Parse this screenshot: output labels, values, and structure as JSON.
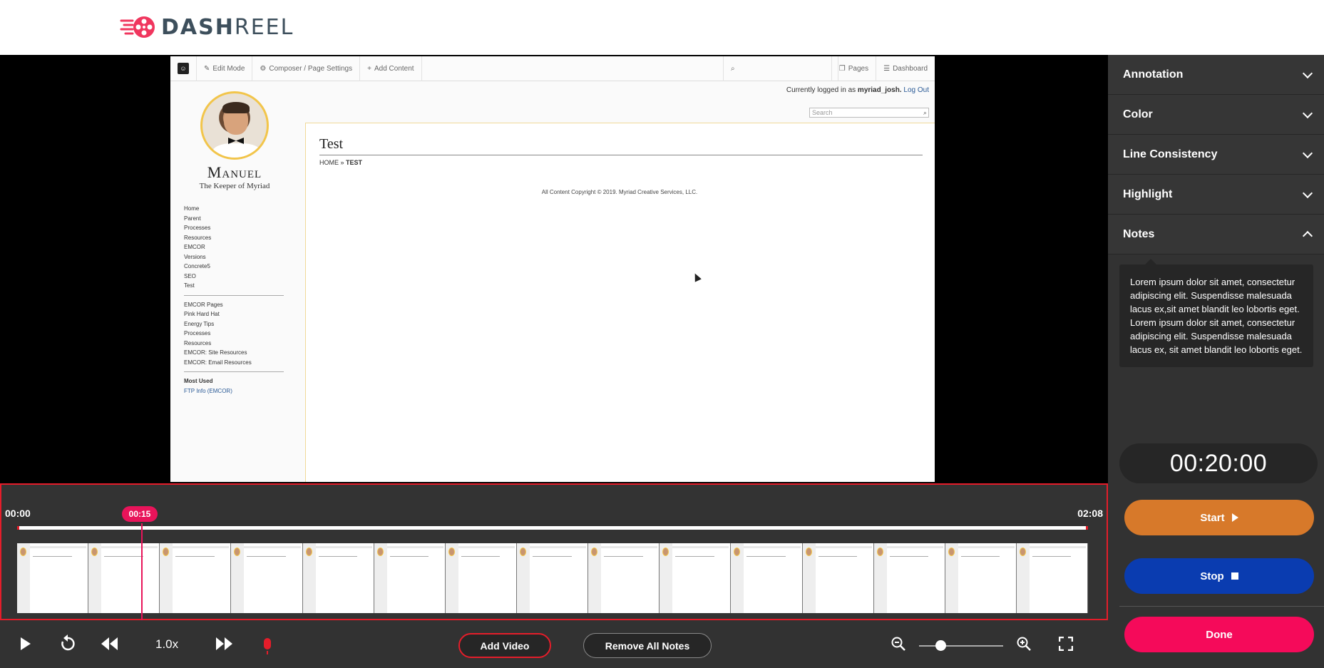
{
  "header": {
    "logo_text_bold": "DASH",
    "logo_text_light": "REEL"
  },
  "screenshot": {
    "toolbar": {
      "edit_mode": "Edit Mode",
      "composer": "Composer / Page Settings",
      "add_content": "Add Content",
      "pages": "Pages",
      "dashboard": "Dashboard"
    },
    "login": {
      "prefix": "Currently logged in as",
      "user": "myriad_josh.",
      "logout": "Log Out"
    },
    "search_placeholder": "Search",
    "site_name": "Manuel",
    "tagline": "The Keeper of Myriad",
    "nav_main": [
      "Home",
      "Parent",
      "Processes",
      "Resources",
      "EMCOR",
      "Versions",
      "Concrete5",
      "SEO",
      "Test"
    ],
    "nav_emcor": [
      "EMCOR Pages",
      "Pink Hard Hat",
      "Energy Tips",
      "Processes",
      "Resources",
      "EMCOR: Site Resources",
      "EMCOR: Email Resources"
    ],
    "most_used_title": "Most Used",
    "most_used_link": "FTP Info (EMCOR)",
    "page_title": "Test",
    "breadcrumb_home": "HOME",
    "breadcrumb_sep": "»",
    "breadcrumb_current": "TEST",
    "copyright": "All Content Copyright © 2019. Myriad Creative Services, LLC."
  },
  "panel": {
    "sections": [
      {
        "label": "Annotation",
        "expanded": false
      },
      {
        "label": "Color",
        "expanded": false
      },
      {
        "label": "Line Consistency",
        "expanded": false
      },
      {
        "label": "Highlight",
        "expanded": false
      },
      {
        "label": "Notes",
        "expanded": true
      }
    ],
    "notes_text": "Lorem ipsum dolor sit amet, consectetur adipiscing elit. Suspendisse malesuada lacus ex,sit amet blandit leo lobortis eget. Lorem ipsum dolor sit amet, consectetur adipiscing elit. Suspendisse malesuada lacus ex, sit amet blandit leo lobortis eget.",
    "timer": "00:20:00",
    "start_label": "Start",
    "stop_label": "Stop",
    "done_label": "Done"
  },
  "timeline": {
    "start": "00:00",
    "current": "00:15",
    "end": "02:08",
    "frame_count": 15,
    "playhead_fraction": 0.117
  },
  "controls": {
    "speed": "1.0x",
    "add_video": "Add Video",
    "remove_notes": "Remove All Notes",
    "zoom_level_fraction": 0.25
  },
  "colors": {
    "accent_red": "#e51d2a",
    "start": "#d7792a",
    "stop": "#0a3cb0",
    "done": "#f50a5a",
    "current_badge": "#e8145a"
  }
}
